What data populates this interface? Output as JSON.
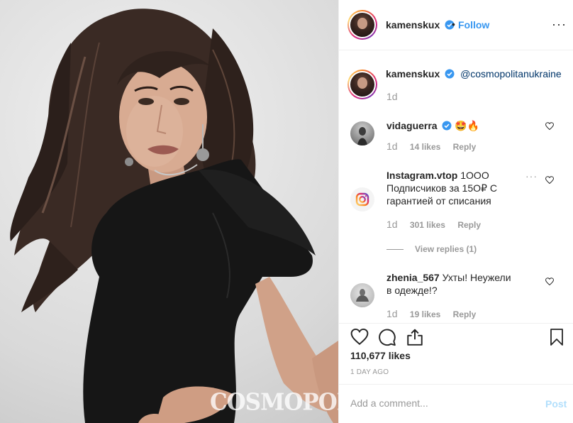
{
  "photo": {
    "watermark": "COSMOPOLITAN"
  },
  "header": {
    "username": "kamenskux",
    "separator": "•",
    "follow_label": "Follow",
    "more_label": "···"
  },
  "caption": {
    "username": "kamenskux",
    "mention": "@cosmopolitanukraine",
    "time": "1d"
  },
  "comments": [
    {
      "username": "vidaguerra",
      "text": "🤩🔥",
      "time": "1d",
      "likes": "14 likes",
      "reply": "Reply"
    },
    {
      "username": "Instagram.vtop",
      "text": "1ООО Подписчиков за 15О₽ С гарантией от списания",
      "time": "1d",
      "likes": "301 likes",
      "reply": "Reply"
    },
    {
      "username": "zhenia_567",
      "text": "Ухты! Неужели в одежде!?",
      "time": "1d",
      "likes": "19 likes",
      "reply": "Reply"
    }
  ],
  "view_replies": "View replies (1)",
  "comment_more": "···",
  "actions": {
    "likes": "110,677 likes",
    "time_ago": "1 DAY AGO"
  },
  "add_comment": {
    "placeholder": "Add a comment...",
    "post_label": "Post"
  },
  "colors": {
    "link": "#3897f0",
    "mention": "#003569",
    "muted": "#999999",
    "post_disabled": "#b2dffc"
  }
}
